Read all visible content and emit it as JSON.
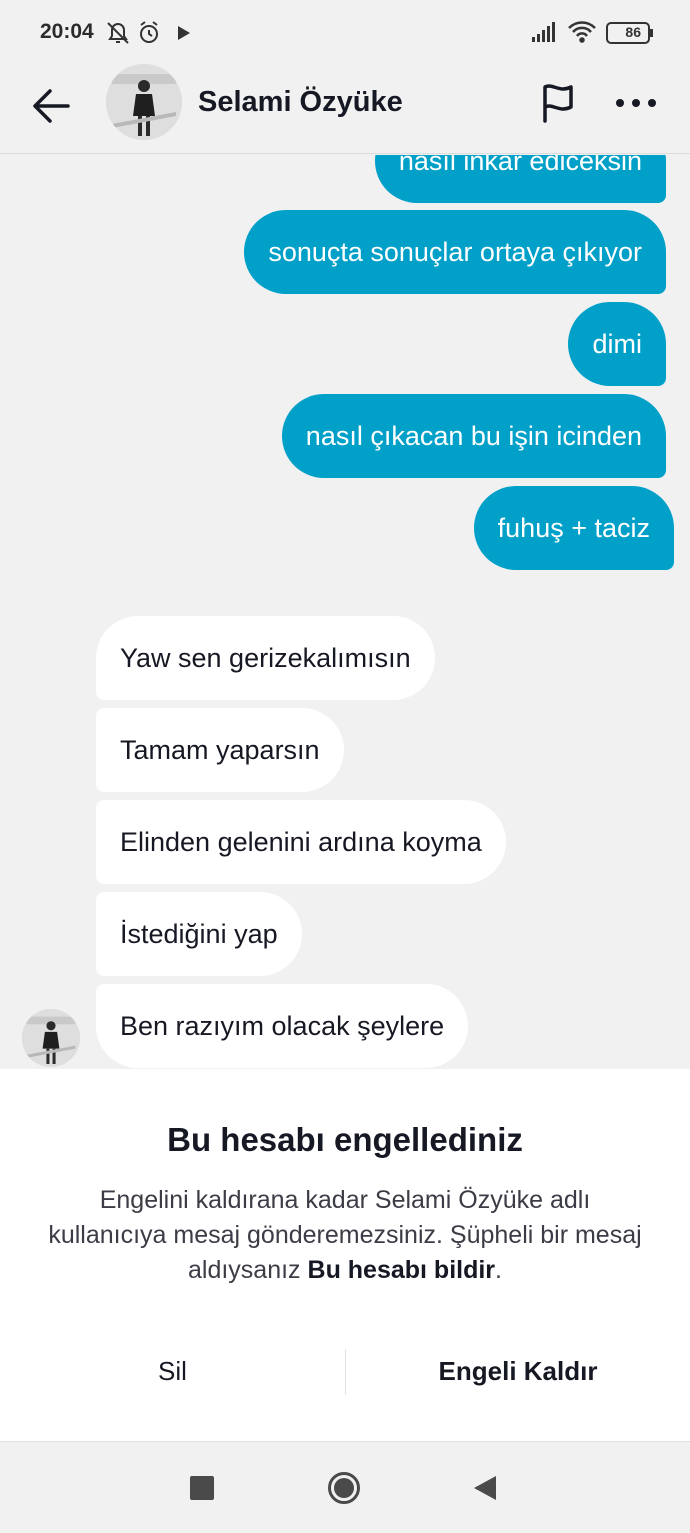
{
  "status_bar": {
    "time": "20:04",
    "left_icons": [
      "bell-off-icon",
      "alarm-icon",
      "play-store-icon"
    ],
    "right_icons": [
      "signal-icon",
      "wifi-icon",
      "battery-icon"
    ],
    "battery": "86"
  },
  "header": {
    "contact_name": "Selami Özyüke",
    "icons": [
      "back-arrow-icon",
      "flag-icon",
      "more-icon"
    ]
  },
  "messages": [
    {
      "from": "me",
      "text": "nasıl inkar ediceksin"
    },
    {
      "from": "me",
      "text": "sonuçta sonuçlar ortaya çıkıyor"
    },
    {
      "from": "me",
      "text": "dimi"
    },
    {
      "from": "me",
      "text": "nasıl çıkacan bu işin icinden"
    },
    {
      "from": "me",
      "text": "fuhuş + taciz"
    },
    {
      "from": "them",
      "text": "Yaw sen gerizekalımısın"
    },
    {
      "from": "them",
      "text": "Tamam yaparsın"
    },
    {
      "from": "them",
      "text": "Elinden gelenini ardına koyma"
    },
    {
      "from": "them",
      "text": "İstediğini yap"
    },
    {
      "from": "them",
      "text": "Ben razıyım olacak şeylere"
    }
  ],
  "blocked": {
    "title": "Bu hesabı engellediniz",
    "description": "Engelini kaldırana kadar Selami Özyüke adlı kullanıcıya mesaj gönderemezsiniz. Şüpheli bir mesaj aldıysanız ",
    "report_link": "Bu hesabı bildir",
    "description_end": ".",
    "delete_label": "Sil",
    "unblock_label": "Engeli Kaldır"
  },
  "colors": {
    "outgoing_bubble": "#00a0c8",
    "incoming_bubble": "#ffffff",
    "background": "#f1f1f2"
  }
}
